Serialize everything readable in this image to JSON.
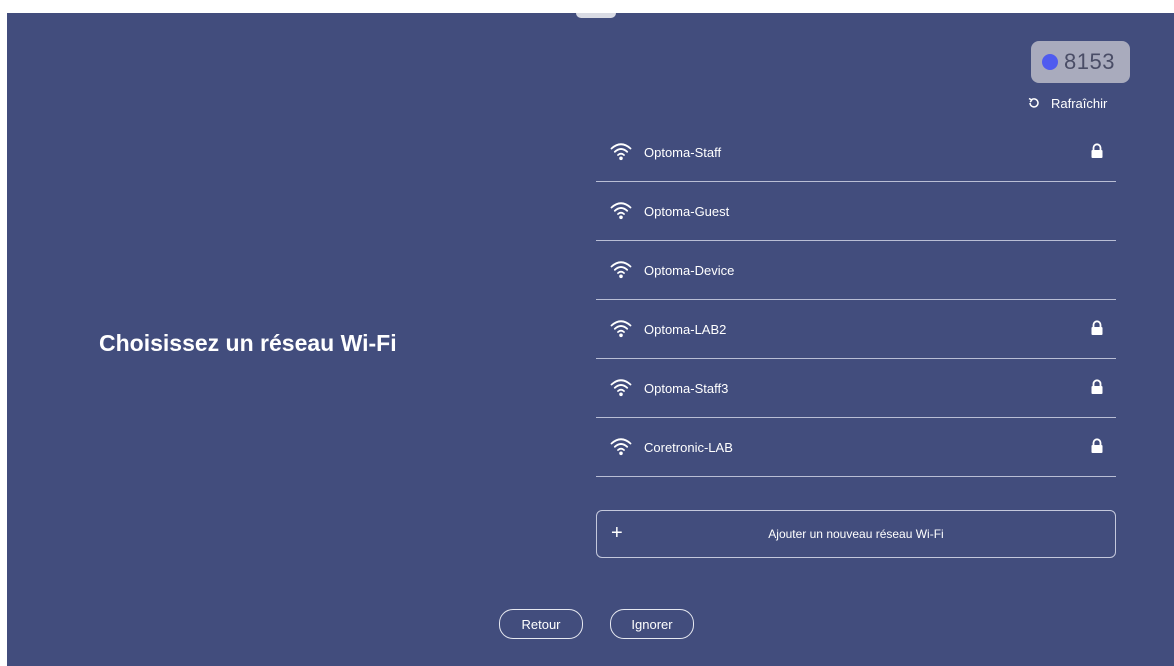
{
  "badge": {
    "value": "8153",
    "dot_color": "#4f5bef"
  },
  "refresh": {
    "label": "Rafraîchir",
    "icon": "refresh-icon"
  },
  "page": {
    "title": "Choisissez un réseau Wi-Fi"
  },
  "networks": [
    {
      "ssid": "Optoma-Staff",
      "secured": true
    },
    {
      "ssid": "Optoma-Guest",
      "secured": false
    },
    {
      "ssid": "Optoma-Device",
      "secured": false
    },
    {
      "ssid": "Optoma-LAB2",
      "secured": true
    },
    {
      "ssid": "Optoma-Staff3",
      "secured": true
    },
    {
      "ssid": "Coretronic-LAB",
      "secured": true
    }
  ],
  "add_network": {
    "icon": "+",
    "label": "Ajouter un nouveau réseau Wi-Fi"
  },
  "actions": {
    "back_label": "Retour",
    "skip_label": "Ignorer"
  },
  "colors": {
    "background": "#424d7d",
    "text": "#ffffff"
  }
}
